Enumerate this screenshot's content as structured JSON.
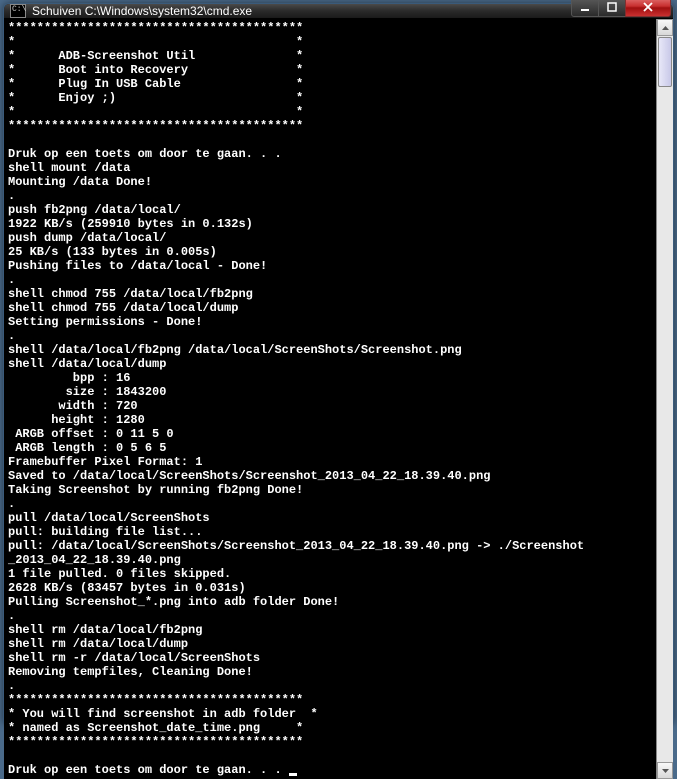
{
  "window": {
    "icon_text": "C:\\",
    "title": "Schuiven C:\\Windows\\system32\\cmd.exe"
  },
  "terminal": {
    "lines": [
      "*****************************************",
      "*                                       *",
      "*      ADB-Screenshot Util              *",
      "*      Boot into Recovery               *",
      "*      Plug In USB Cable                *",
      "*      Enjoy ;)                         *",
      "*                                       *",
      "*****************************************",
      "",
      "Druk op een toets om door te gaan. . .",
      "shell mount /data",
      "Mounting /data Done!",
      ".",
      "push fb2png /data/local/",
      "1922 KB/s (259910 bytes in 0.132s)",
      "push dump /data/local/",
      "25 KB/s (133 bytes in 0.005s)",
      "Pushing files to /data/local - Done!",
      ".",
      "shell chmod 755 /data/local/fb2png",
      "shell chmod 755 /data/local/dump",
      "Setting permissions - Done!",
      ".",
      "shell /data/local/fb2png /data/local/ScreenShots/Screenshot.png",
      "shell /data/local/dump",
      "         bpp : 16",
      "        size : 1843200",
      "       width : 720",
      "      height : 1280",
      " ARGB offset : 0 11 5 0",
      " ARGB length : 0 5 6 5",
      "Framebuffer Pixel Format: 1",
      "Saved to /data/local/ScreenShots/Screenshot_2013_04_22_18.39.40.png",
      "Taking Screenshot by running fb2png Done!",
      ".",
      "pull /data/local/ScreenShots",
      "pull: building file list...",
      "pull: /data/local/ScreenShots/Screenshot_2013_04_22_18.39.40.png -> ./Screenshot",
      "_2013_04_22_18.39.40.png",
      "1 file pulled. 0 files skipped.",
      "2628 KB/s (83457 bytes in 0.031s)",
      "Pulling Screenshot_*.png into adb folder Done!",
      ".",
      "shell rm /data/local/fb2png",
      "shell rm /data/local/dump",
      "shell rm -r /data/local/ScreenShots",
      "Removing tempfiles, Cleaning Done!",
      ".",
      "*****************************************",
      "* You will find screenshot in adb folder  *",
      "* named as Screenshot_date_time.png     *",
      "*****************************************",
      "",
      "Druk op een toets om door te gaan. . . "
    ]
  }
}
